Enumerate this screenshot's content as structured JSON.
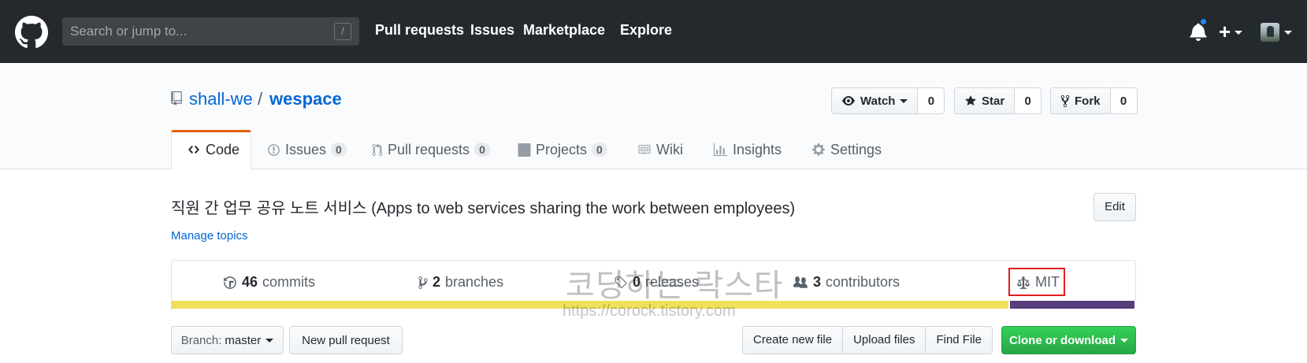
{
  "topnav": {
    "search_placeholder": "Search or jump to...",
    "search_shortcut": "/",
    "links": [
      "Pull requests",
      "Issues",
      "Marketplace",
      "Explore"
    ],
    "plus_label": "+"
  },
  "repo": {
    "owner": "shall-we",
    "separator": "/",
    "name": "wespace",
    "watch_label": "Watch",
    "watch_count": "0",
    "star_label": "Star",
    "star_count": "0",
    "fork_label": "Fork",
    "fork_count": "0"
  },
  "tabs": [
    {
      "label": "Code",
      "icon": "code-icon",
      "selected": true
    },
    {
      "label": "Issues",
      "icon": "issue-icon",
      "count": "0"
    },
    {
      "label": "Pull requests",
      "icon": "pull-request-icon",
      "count": "0"
    },
    {
      "label": "Projects",
      "icon": "project-icon",
      "count": "0"
    },
    {
      "label": "Wiki",
      "icon": "book-icon"
    },
    {
      "label": "Insights",
      "icon": "graph-icon"
    },
    {
      "label": "Settings",
      "icon": "gear-icon"
    }
  ],
  "description": "직원 간 업무 공유 노트 서비스 (Apps to web services sharing the work between employees)",
  "edit_label": "Edit",
  "manage_topics": "Manage topics",
  "summary": {
    "commits_num": "46",
    "commits_label": "commits",
    "branches_num": "2",
    "branches_label": "branches",
    "releases_num": "0",
    "releases_label": "releases",
    "contributors_num": "3",
    "contributors_label": "contributors",
    "license": "MIT"
  },
  "languages": [
    {
      "color": "#f1e05a",
      "share": 0.868
    },
    {
      "color": "#563d7c",
      "share": 0.13
    },
    {
      "color": "#e34c26",
      "share": 0.002
    }
  ],
  "watermark": {
    "text": "코딩하는 락스타",
    "url": "https://corock.tistory.com"
  },
  "toolbar": {
    "branch_prefix": "Branch:",
    "branch_name": "master",
    "new_pr": "New pull request",
    "create_file": "Create new file",
    "upload_files": "Upload files",
    "find_file": "Find File",
    "clone": "Clone or download"
  },
  "colors": {
    "header_bg": "#24292e",
    "link": "#0366d6",
    "tab_accent": "#e36209",
    "primary_green": "#28a745",
    "highlight_red": "#e11d21"
  }
}
